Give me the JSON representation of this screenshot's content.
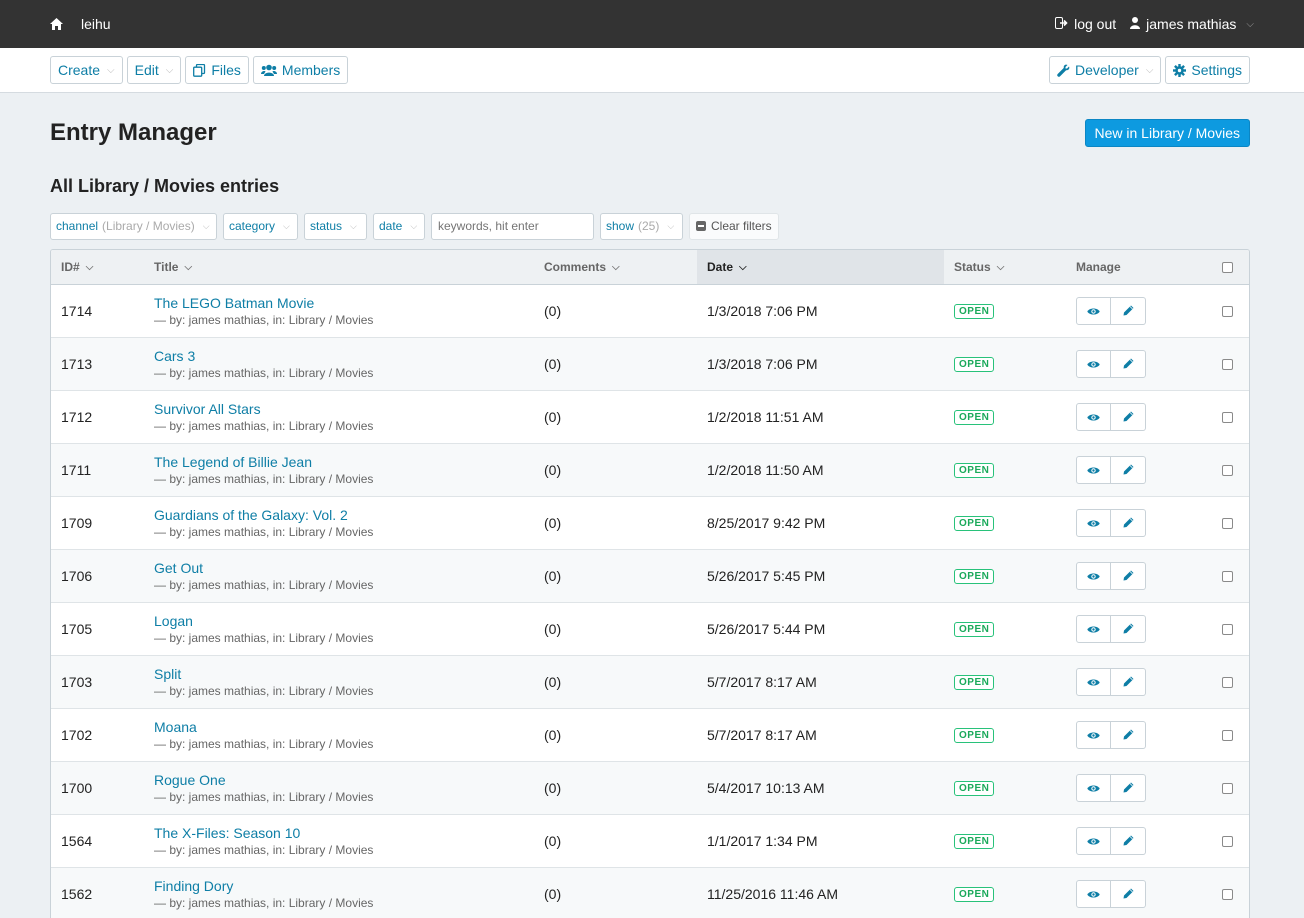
{
  "topbar": {
    "site_name": "leihu",
    "logout_label": "log out",
    "user_name": "james mathias"
  },
  "nav": {
    "create": "Create",
    "edit": "Edit",
    "files": "Files",
    "members": "Members",
    "developer": "Developer",
    "settings": "Settings"
  },
  "page": {
    "title": "Entry Manager",
    "new_button": "New in Library / Movies",
    "subtitle": "All Library / Movies entries"
  },
  "filters": {
    "channel_label": "channel",
    "channel_value": "(Library / Movies)",
    "category_label": "category",
    "status_label": "status",
    "date_label": "date",
    "search_placeholder": "keywords, hit enter",
    "show_label": "show",
    "show_value": "(25)",
    "clear_label": "Clear filters"
  },
  "table": {
    "headers": {
      "id": "ID#",
      "title": "Title",
      "comments": "Comments",
      "date": "Date",
      "status": "Status",
      "manage": "Manage"
    },
    "sorted_column": "date",
    "rows": [
      {
        "id": "1714",
        "title": "The LEGO Batman Movie",
        "meta": "— by: james mathias, in: Library / Movies",
        "comments": "(0)",
        "date": "1/3/2018 7:06 PM",
        "status": "OPEN"
      },
      {
        "id": "1713",
        "title": "Cars 3",
        "meta": "— by: james mathias, in: Library / Movies",
        "comments": "(0)",
        "date": "1/3/2018 7:06 PM",
        "status": "OPEN"
      },
      {
        "id": "1712",
        "title": "Survivor All Stars",
        "meta": "— by: james mathias, in: Library / Movies",
        "comments": "(0)",
        "date": "1/2/2018 11:51 AM",
        "status": "OPEN"
      },
      {
        "id": "1711",
        "title": "The Legend of Billie Jean",
        "meta": "— by: james mathias, in: Library / Movies",
        "comments": "(0)",
        "date": "1/2/2018 11:50 AM",
        "status": "OPEN"
      },
      {
        "id": "1709",
        "title": "Guardians of the Galaxy: Vol. 2",
        "meta": "— by: james mathias, in: Library / Movies",
        "comments": "(0)",
        "date": "8/25/2017 9:42 PM",
        "status": "OPEN"
      },
      {
        "id": "1706",
        "title": "Get Out",
        "meta": "— by: james mathias, in: Library / Movies",
        "comments": "(0)",
        "date": "5/26/2017 5:45 PM",
        "status": "OPEN"
      },
      {
        "id": "1705",
        "title": "Logan",
        "meta": "— by: james mathias, in: Library / Movies",
        "comments": "(0)",
        "date": "5/26/2017 5:44 PM",
        "status": "OPEN"
      },
      {
        "id": "1703",
        "title": "Split",
        "meta": "— by: james mathias, in: Library / Movies",
        "comments": "(0)",
        "date": "5/7/2017 8:17 AM",
        "status": "OPEN"
      },
      {
        "id": "1702",
        "title": "Moana",
        "meta": "— by: james mathias, in: Library / Movies",
        "comments": "(0)",
        "date": "5/7/2017 8:17 AM",
        "status": "OPEN"
      },
      {
        "id": "1700",
        "title": "Rogue One",
        "meta": "— by: james mathias, in: Library / Movies",
        "comments": "(0)",
        "date": "5/4/2017 10:13 AM",
        "status": "OPEN"
      },
      {
        "id": "1564",
        "title": "The X-Files: Season 10",
        "meta": "— by: james mathias, in: Library / Movies",
        "comments": "(0)",
        "date": "1/1/2017 1:34 PM",
        "status": "OPEN"
      },
      {
        "id": "1562",
        "title": "Finding Dory",
        "meta": "— by: james mathias, in: Library / Movies",
        "comments": "(0)",
        "date": "11/25/2016 11:46 AM",
        "status": "OPEN"
      }
    ]
  },
  "colors": {
    "accent": "#0e7ea6",
    "primary_button": "#0d9ae0",
    "status_open": "#1aa95a",
    "topbar": "#333333"
  },
  "icons": {
    "home": "home-icon",
    "logout": "sign-out-icon",
    "user": "user-icon",
    "files": "files-icon",
    "members": "users-icon",
    "developer": "wrench-icon",
    "settings": "gear-icon",
    "view": "eye-icon",
    "edit": "pencil-icon"
  }
}
